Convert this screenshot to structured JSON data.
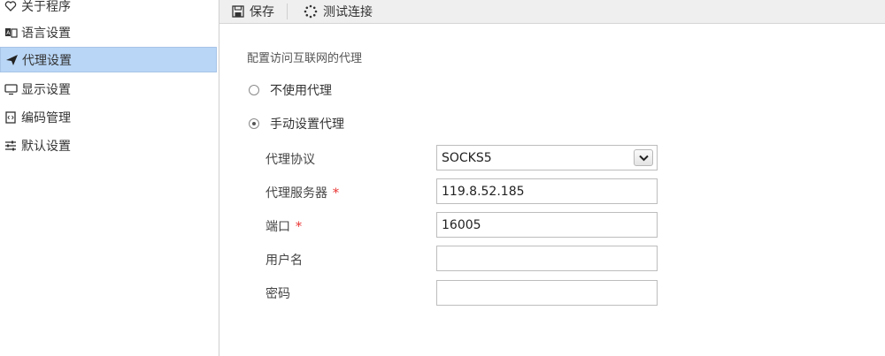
{
  "sidebar": {
    "items": [
      {
        "label": "关于程序",
        "icon": "heart-icon"
      },
      {
        "label": "语言设置",
        "icon": "language-icon"
      },
      {
        "label": "代理设置",
        "icon": "paper-plane-icon",
        "active": true
      },
      {
        "label": "显示设置",
        "icon": "monitor-icon"
      },
      {
        "label": "编码管理",
        "icon": "code-file-icon"
      },
      {
        "label": "默认设置",
        "icon": "sliders-icon"
      }
    ]
  },
  "toolbar": {
    "save_label": "保存",
    "test_label": "测试连接"
  },
  "proxy": {
    "section_title": "配置访问互联网的代理",
    "option_none": "不使用代理",
    "option_manual": "手动设置代理",
    "selected": "manual",
    "protocol_label": "代理协议",
    "protocol_value": "SOCKS5",
    "server_label": "代理服务器",
    "server_value": "119.8.52.185",
    "port_label": "端口",
    "port_value": "16005",
    "username_label": "用户名",
    "username_value": "",
    "password_label": "密码",
    "password_value": "",
    "required_mark": "*"
  },
  "colors": {
    "active_bg": "#b9d6f6",
    "required": "#e8312f",
    "toolbar_bg": "#efefef"
  }
}
